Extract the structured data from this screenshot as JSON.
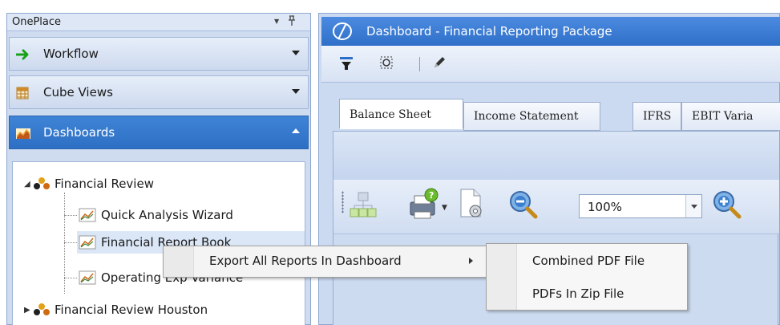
{
  "onePlace": {
    "title": "OnePlace",
    "dropdown_glyph": "▼",
    "pin_glyph": "ᵖ",
    "sections": [
      {
        "label": "Workflow",
        "icon": "green-arrow-icon"
      },
      {
        "label": "Cube Views",
        "icon": "grid-icon"
      },
      {
        "label": "Dashboards",
        "icon": "chart-icon",
        "active": true
      }
    ],
    "tree": {
      "group1": "Financial Review",
      "items": [
        "Quick Analysis Wizard",
        "Financial Report Book",
        "Operating Exp Variance"
      ],
      "group2": "Financial Review Houston"
    }
  },
  "dashboard": {
    "title": "Dashboard - Financial Reporting Package",
    "toolbar": [
      "filter-icon",
      "refresh-icon",
      "pencil-icon"
    ],
    "tabs": [
      "Balance Sheet",
      "Income Statement",
      "IFRS",
      "EBIT Varia"
    ],
    "active_tab": "Balance Sheet",
    "zoom": "100%"
  },
  "context_menu": {
    "item": "Export All Reports In Dashboard",
    "submenu": [
      "Combined PDF File",
      "PDFs In Zip File"
    ]
  },
  "colors": {
    "accent": "#2e6fc8",
    "panel": "#cfdcf0"
  }
}
